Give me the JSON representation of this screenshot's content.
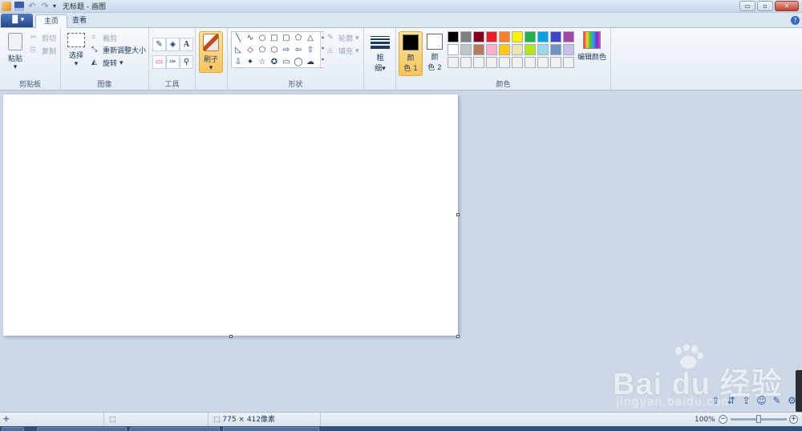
{
  "window": {
    "title": "无标题 - 画图",
    "min_label": "▭",
    "max_label": "▫",
    "close_label": "✕"
  },
  "quick_access": {
    "undo_glyph": "↶",
    "redo_glyph": "↷",
    "dropdown_glyph": "▾"
  },
  "tabs": {
    "file_label": "▐▌▾",
    "items": [
      {
        "label": "主页",
        "active": true
      },
      {
        "label": "查看",
        "active": false
      }
    ],
    "help_glyph": "?"
  },
  "ribbon": {
    "clipboard": {
      "group_label": "剪贴板",
      "paste_label": "粘贴",
      "cut_label": "剪切",
      "copy_label": "复制"
    },
    "image": {
      "group_label": "图像",
      "select_label": "选择",
      "crop_label": "裁剪",
      "resize_label": "重新调整大小",
      "rotate_label": "旋转"
    },
    "tools": {
      "group_label": "工具",
      "pencil": "✎",
      "fill": "◈",
      "text": "A",
      "eraser": "▭",
      "picker": "✑",
      "magnifier": "⚲"
    },
    "brushes": {
      "label": "刷子"
    },
    "shapes": {
      "group_label": "形状",
      "outline_label": "轮廓",
      "fill_label": "填充",
      "glyphs": [
        "╲",
        "∿",
        "○",
        "□",
        "▢",
        "⬠",
        "△",
        "◺",
        "◇",
        "⬠",
        "⬡",
        "⇨",
        "⇦",
        "⇧",
        "⇩",
        "✦",
        "☆",
        "✪",
        "▭",
        "◯",
        "☁"
      ]
    },
    "size": {
      "label_1": "粗",
      "label_2": "细"
    },
    "colors": {
      "group_label": "颜色",
      "color1_label_1": "颜",
      "color1_label_2": "色 1",
      "color2_label_1": "颜",
      "color2_label_2": "色 2",
      "color1_value": "#000000",
      "color2_value": "#ffffff",
      "edit_label": "编辑颜色",
      "palette_row1": [
        "#000000",
        "#7f7f7f",
        "#880015",
        "#ed1c24",
        "#ff7f27",
        "#fff200",
        "#22b14c",
        "#00a2e8",
        "#3f48cc",
        "#a349a4"
      ],
      "palette_row2": [
        "#ffffff",
        "#c3c3c3",
        "#b97a57",
        "#ffaec9",
        "#ffc90e",
        "#efe4b0",
        "#b5e61d",
        "#99d9ea",
        "#7092be",
        "#c8bfe7"
      ],
      "palette_row3": [
        "#f0f0f0",
        "#f0f0f0",
        "#f0f0f0",
        "#f0f0f0",
        "#f0f0f0",
        "#f0f0f0",
        "#f0f0f0",
        "#f0f0f0",
        "#f0f0f0",
        "#f0f0f0"
      ]
    }
  },
  "canvas": {
    "background": "#ffffff"
  },
  "watermark": {
    "brand": "Bai du 经验",
    "url": "jingyan.baidu.com"
  },
  "floating_toolbar": [
    "⇧",
    "⇵",
    "⇪",
    "☺",
    "✎",
    "⚙"
  ],
  "status": {
    "cursor_glyph": "✛",
    "selection_glyph": "⬚",
    "size_glyph": "⬚",
    "size_text": "775 × 412像素",
    "zoom_text": "100%",
    "zoom_out": "−",
    "zoom_in": "+",
    "zoom_fraction": 0.5
  }
}
